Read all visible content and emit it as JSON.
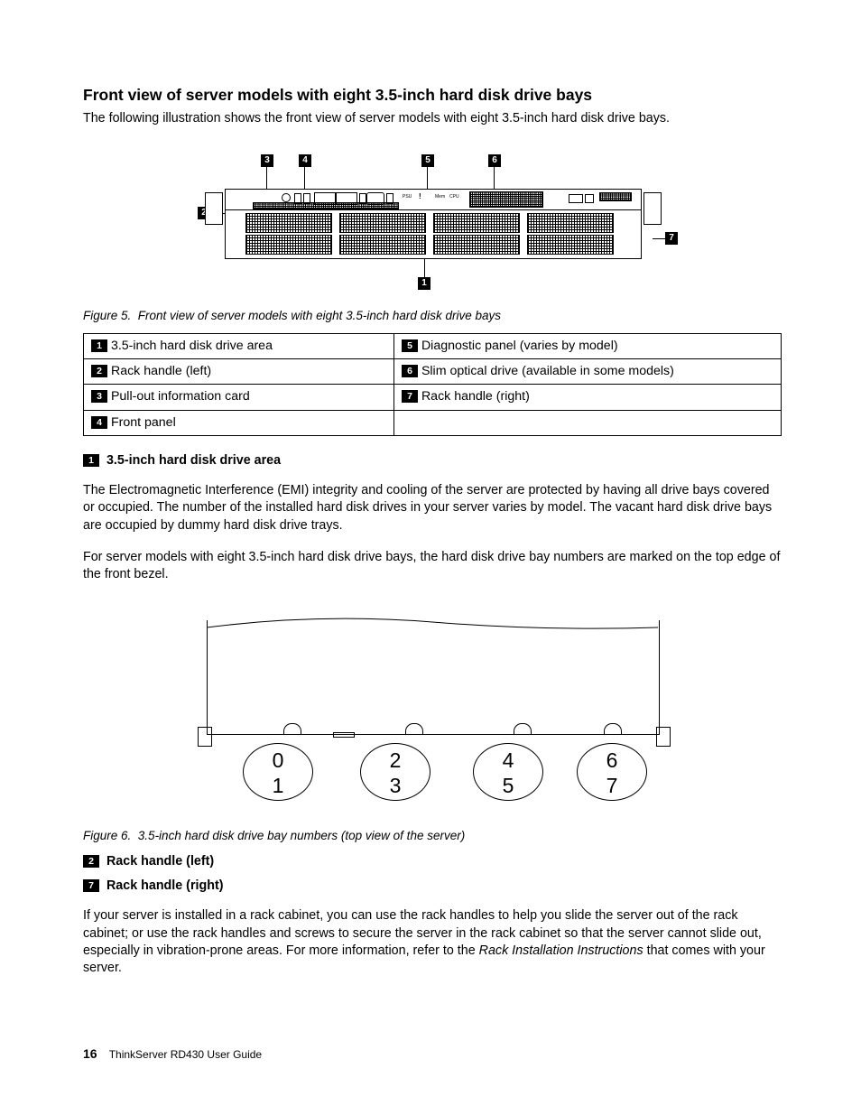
{
  "heading": "Front view of server models with eight 3.5-inch hard disk drive bays",
  "intro": "The following illustration shows the front view of server models with eight 3.5-inch hard disk drive bays.",
  "figure5": {
    "caption_prefix": "Figure 5.",
    "caption": "Front view of server models with eight 3.5-inch hard disk drive bays",
    "callouts": {
      "c1": "1",
      "c2": "2",
      "c3": "3",
      "c4": "4",
      "c5": "5",
      "c6": "6",
      "c7": "7"
    },
    "panel_labels": {
      "psu": "PSU",
      "mem": "Mem",
      "cpu": "CPU",
      "bang": "!"
    }
  },
  "legend": {
    "r1": {
      "num": "1",
      "text": "3.5-inch hard disk drive area"
    },
    "r2": {
      "num": "2",
      "text": "Rack handle (left)"
    },
    "r3": {
      "num": "3",
      "text": "Pull-out information card"
    },
    "r4": {
      "num": "4",
      "text": "Front panel"
    },
    "r5": {
      "num": "5",
      "text": "Diagnostic panel (varies by model)"
    },
    "r6": {
      "num": "6",
      "text": "Slim optical drive (available in some models)"
    },
    "r7": {
      "num": "7",
      "text": "Rack handle (right)"
    }
  },
  "section1": {
    "num": "1",
    "title": "3.5-inch hard disk drive area",
    "para1": "The Electromagnetic Interference (EMI) integrity and cooling of the server are protected by having all drive bays covered or occupied. The number of the installed hard disk drives in your server varies by model. The vacant hard disk drive bays are occupied by dummy hard disk drive trays.",
    "para2": "For server models with eight 3.5-inch hard disk drive bays, the hard disk drive bay numbers are marked on the top edge of the front bezel."
  },
  "figure6": {
    "caption_prefix": "Figure 6.",
    "caption": "3.5-inch hard disk drive bay numbers (top view of the server)",
    "bays": {
      "b0": "0",
      "b1": "1",
      "b2": "2",
      "b3": "3",
      "b4": "4",
      "b5": "5",
      "b6": "6",
      "b7": "7"
    }
  },
  "section2": {
    "num": "2",
    "title": "Rack handle (left)"
  },
  "section7": {
    "num": "7",
    "title": "Rack handle (right)"
  },
  "rack_para_a": "If your server is installed in a rack cabinet, you can use the rack handles to help you slide the server out of the rack cabinet; or use the rack handles and screws to secure the server in the rack cabinet so that the server cannot slide out, especially in vibration-prone areas. For more information, refer to the ",
  "rack_para_em": "Rack Installation Instructions",
  "rack_para_b": " that comes with your server.",
  "footer": {
    "page": "16",
    "doc": "ThinkServer RD430 User Guide"
  }
}
